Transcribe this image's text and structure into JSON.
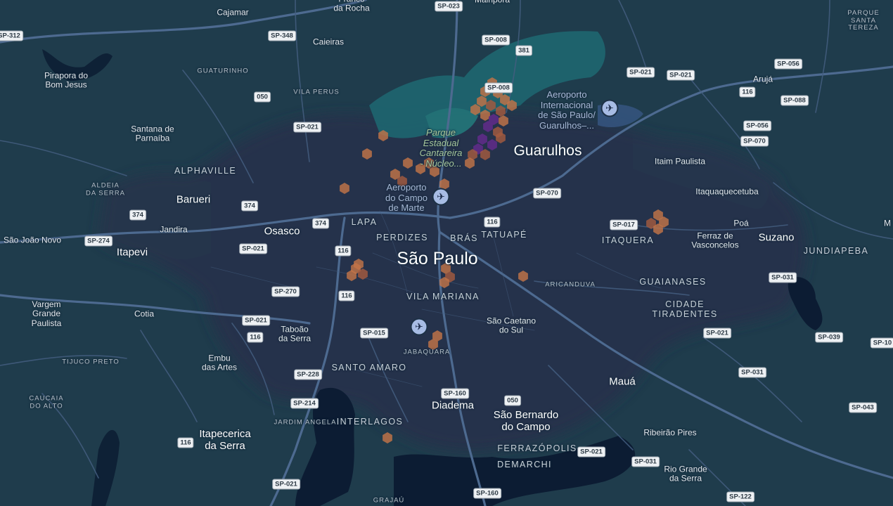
{
  "map": {
    "cities": [
      {
        "key": "sao-paulo",
        "label": "São Paulo",
        "tier": "xl"
      },
      {
        "key": "guarulhos",
        "label": "Guarulhos",
        "tier": "l"
      },
      {
        "key": "osasco",
        "label": "Osasco",
        "tier": "m"
      },
      {
        "key": "barueri",
        "label": "Barueri",
        "tier": "m"
      },
      {
        "key": "itapevi",
        "label": "Itapevi",
        "tier": "m"
      },
      {
        "key": "suzano",
        "label": "Suzano",
        "tier": "m"
      },
      {
        "key": "maua",
        "label": "Mauá",
        "tier": "m"
      },
      {
        "key": "diadema",
        "label": "Diadema",
        "tier": "m"
      },
      {
        "key": "sao-bernardo",
        "label": "São Bernardo\ndo Campo",
        "tier": "m"
      },
      {
        "key": "itapecerica",
        "label": "Itapecerica\nda Serra",
        "tier": "m"
      }
    ],
    "towns": [
      {
        "key": "cajamar",
        "label": "Cajamar"
      },
      {
        "key": "franco-rocha",
        "label": "Franco\nda Rocha"
      },
      {
        "key": "mairipora",
        "label": "Mairiporã"
      },
      {
        "key": "caieiras",
        "label": "Caieiras"
      },
      {
        "key": "pirapora",
        "label": "Pirapora do\nBom Jesus"
      },
      {
        "key": "santana-parnaiba",
        "label": "Santana de\nParnaíba"
      },
      {
        "key": "jandira",
        "label": "Jandira"
      },
      {
        "key": "sao-joao-novo",
        "label": "São João Novo"
      },
      {
        "key": "aruja",
        "label": "Arujá"
      },
      {
        "key": "itaim-paulista",
        "label": "Itaim Paulista"
      },
      {
        "key": "itaquaquecetuba",
        "label": "Itaquaquecetuba"
      },
      {
        "key": "poa",
        "label": "Poá"
      },
      {
        "key": "ferraz",
        "label": "Ferraz de\nVasconcelos"
      },
      {
        "key": "vargem-grande",
        "label": "Vargem\nGrande\nPaulista"
      },
      {
        "key": "cotia",
        "label": "Cotia"
      },
      {
        "key": "taboao",
        "label": "Taboão\nda Serra"
      },
      {
        "key": "embu",
        "label": "Embu\ndas Artes"
      },
      {
        "key": "sao-caetano",
        "label": "São Caetano\ndo Sul"
      },
      {
        "key": "ribeirao-pires",
        "label": "Ribeirão Pires"
      },
      {
        "key": "rio-grande-serra",
        "label": "Rio Grande\nda Serra"
      },
      {
        "key": "edge-m",
        "label": "M"
      }
    ],
    "neighborhoods": [
      {
        "key": "alphaville",
        "label": "ALPHAVILLE",
        "size": "m"
      },
      {
        "key": "aldeia-serra",
        "label": "ALDEIA\nDA SERRA",
        "size": "s"
      },
      {
        "key": "guaturinho",
        "label": "GUATURINHO",
        "size": "s"
      },
      {
        "key": "vila-perus",
        "label": "VILA PERUS",
        "size": "s"
      },
      {
        "key": "parque-santa-tereza",
        "label": "PARQUE\nSANTA TEREZA",
        "size": "s"
      },
      {
        "key": "lapa",
        "label": "LAPA",
        "size": "m"
      },
      {
        "key": "perdizes",
        "label": "PERDIZES",
        "size": "m"
      },
      {
        "key": "bras",
        "label": "BRÁS",
        "size": "m"
      },
      {
        "key": "tatuape",
        "label": "TATUAPÉ",
        "size": "m"
      },
      {
        "key": "itaquera",
        "label": "ITAQUERA",
        "size": "m"
      },
      {
        "key": "jundiapeba",
        "label": "JUNDIAPEBA",
        "size": "m"
      },
      {
        "key": "aricanduva",
        "label": "ARICANDUVA",
        "size": "s"
      },
      {
        "key": "guaianases",
        "label": "GUAIANASES",
        "size": "m"
      },
      {
        "key": "cidade-tiradentes",
        "label": "CIDADE\nTIRADENTES",
        "size": "m"
      },
      {
        "key": "vila-mariana",
        "label": "VILA MARIANA",
        "size": "m"
      },
      {
        "key": "jabaquara",
        "label": "JABAQUARA",
        "size": "s"
      },
      {
        "key": "santo-amaro",
        "label": "SANTO AMARO",
        "size": "m"
      },
      {
        "key": "tijuco-preto",
        "label": "TIJUCO PRETO",
        "size": "s"
      },
      {
        "key": "caucaia-alto",
        "label": "CAUCAIA\nDO ALTO",
        "size": "s"
      },
      {
        "key": "jardim-angela",
        "label": "JARDIM ANGELA",
        "size": "s"
      },
      {
        "key": "interlagos",
        "label": "INTERLAGOS",
        "size": "m"
      },
      {
        "key": "ferrazopolis",
        "label": "FERRAZÓPOLIS",
        "size": "m"
      },
      {
        "key": "demarchi",
        "label": "DEMARCHI",
        "size": "m"
      },
      {
        "key": "grajau",
        "label": "GRAJAÚ",
        "size": "s"
      }
    ],
    "pois": [
      {
        "key": "gru-airport",
        "label": "Aeroporto\nInternacional\nde São Paulo/\nGuarulhos–...",
        "type": "airport"
      },
      {
        "key": "campo-de-marte",
        "label": "Aeroporto\ndo Campo\nde Marte",
        "type": "airport"
      },
      {
        "key": "cantareira",
        "label": "Parque\nEstadual\nCantareira\n- Núcleo...",
        "type": "park"
      }
    ],
    "highways": [
      "SP-023",
      "SP-312",
      "SP-348",
      "SP-008",
      "381",
      "SP-021",
      "050",
      "SP-056",
      "116",
      "SP-088",
      "SP-070",
      "374",
      "SP-274",
      "SP-017",
      "SP-270",
      "SP-015",
      "SP-228",
      "SP-214",
      "SP-160",
      "SP-031",
      "SP-039",
      "SP-043",
      "SP-122",
      "SP-10"
    ],
    "colors": {
      "background": "#1f3c4c",
      "urban": "#24304a",
      "road": "#445e80",
      "water": "#0c1c33",
      "park": "#1e6670",
      "heat_light": "#c27448",
      "heat_mid": "#a45a40",
      "heat_dark": "#5b2c84"
    }
  }
}
